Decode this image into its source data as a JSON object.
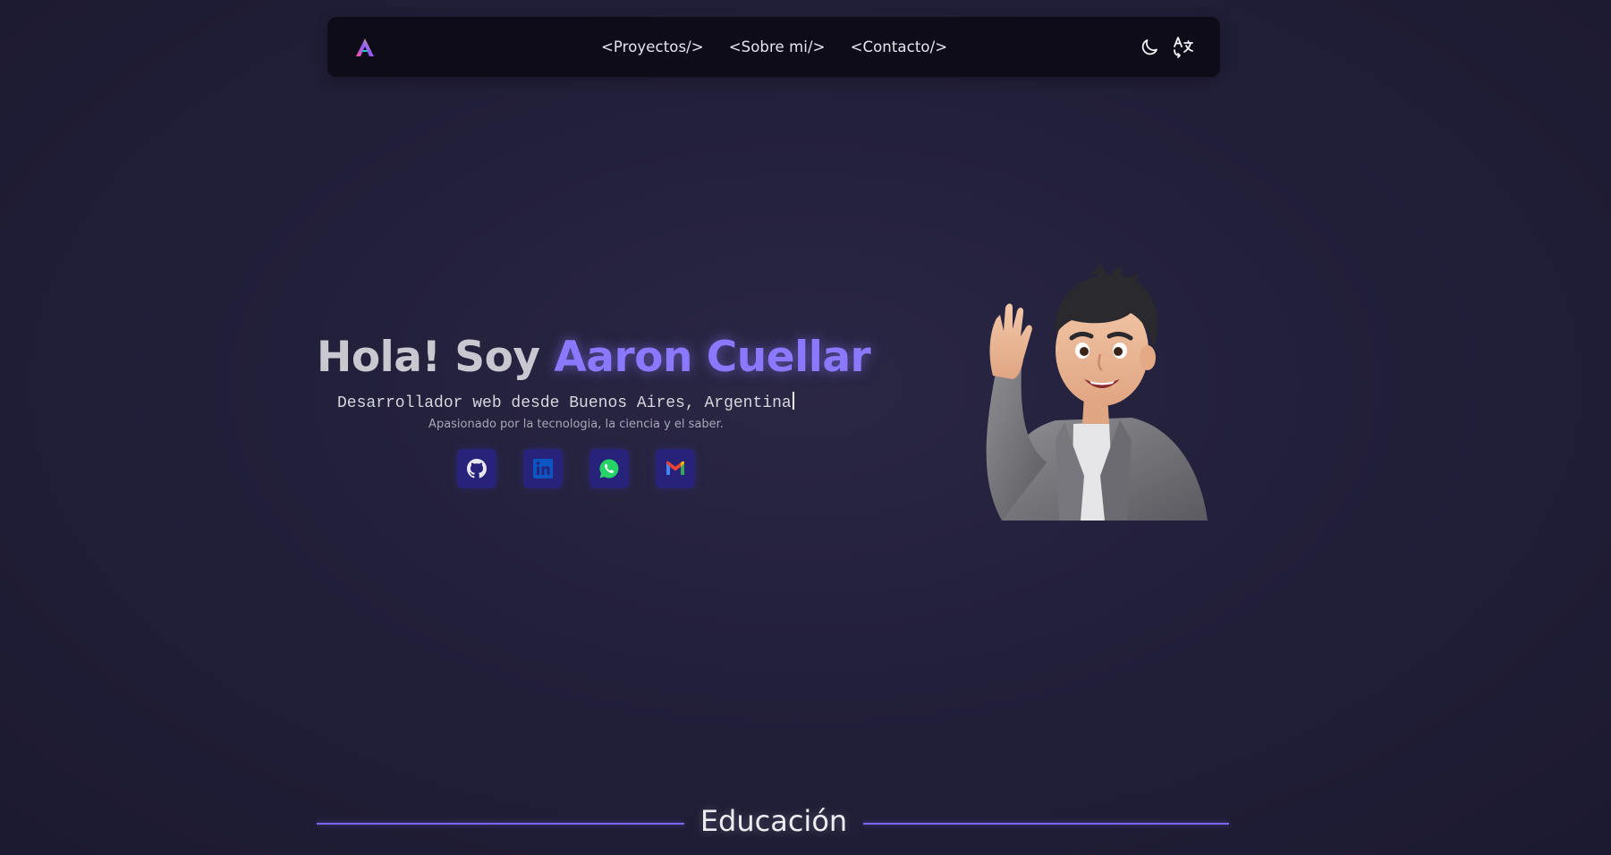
{
  "nav": {
    "links": [
      "<Proyectos/>",
      "<Sobre mi/>",
      "<Contacto/>"
    ],
    "theme_icon": "moon-icon",
    "language_icon": "translate-icon",
    "logo_icon": "logo-a-icon"
  },
  "hero": {
    "greeting": "Hola! Soy ",
    "name": "Aaron Cuellar",
    "subtitle": "Desarrollador web desde Buenos Aires, Argentina",
    "tagline": "Apasionado por la tecnologia, la ciencia y el saber.",
    "socials": [
      "github-icon",
      "linkedin-icon",
      "whatsapp-icon",
      "gmail-icon"
    ]
  },
  "education": {
    "title": "Educación"
  },
  "colors": {
    "accent": "#8a78ff",
    "background": "#221f3a",
    "navbar": "#0d0c18",
    "social_button": "#28237a"
  }
}
